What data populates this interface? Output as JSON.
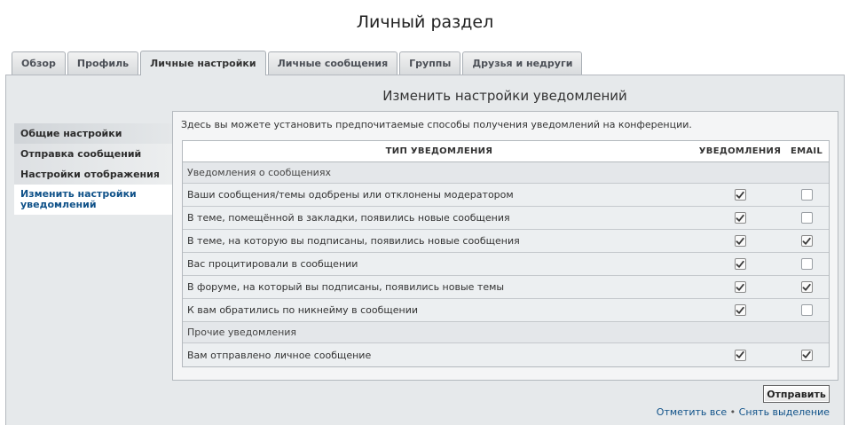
{
  "page": {
    "title": "Личный раздел"
  },
  "tabs": [
    {
      "label": "Обзор",
      "active": false
    },
    {
      "label": "Профиль",
      "active": false
    },
    {
      "label": "Личные настройки",
      "active": true
    },
    {
      "label": "Личные сообщения",
      "active": false
    },
    {
      "label": "Группы",
      "active": false
    },
    {
      "label": "Друзья и недруги",
      "active": false
    }
  ],
  "section": {
    "title": "Изменить настройки уведомлений"
  },
  "sidebar": {
    "items": [
      {
        "label": "Общие настройки",
        "active": false
      },
      {
        "label": "Отправка сообщений",
        "active": false
      },
      {
        "label": "Настройки отображения",
        "active": false
      },
      {
        "label": "Изменить настройки уведомлений",
        "active": true
      }
    ]
  },
  "intro_text": "Здесь вы можете установить предпочитаемые способы получения уведомлений на конференции.",
  "table": {
    "headers": {
      "type": "ТИП УВЕДОМЛЕНИЯ",
      "notifications": "УВЕДОМЛЕНИЯ",
      "email": "EMAIL"
    },
    "groups": [
      {
        "title": "Уведомления о сообщениях",
        "rows": [
          {
            "label": "Ваши сообщения/темы одобрены или отклонены модератором",
            "notification": true,
            "email": false
          },
          {
            "label": "В теме, помещённой в закладки, появились новые сообщения",
            "notification": true,
            "email": false
          },
          {
            "label": "В теме, на которую вы подписаны, появились новые сообщения",
            "notification": true,
            "email": true
          },
          {
            "label": "Вас процитировали в сообщении",
            "notification": true,
            "email": false
          },
          {
            "label": "В форуме, на который вы подписаны, появились новые темы",
            "notification": true,
            "email": true
          },
          {
            "label": "К вам обратились по никнейму в сообщении",
            "notification": true,
            "email": false
          }
        ]
      },
      {
        "title": "Прочие уведомления",
        "rows": [
          {
            "label": "Вам отправлено личное сообщение",
            "notification": true,
            "email": true
          }
        ]
      }
    ]
  },
  "actions": {
    "submit_label": "Отправить",
    "mark_all_label": "Отметить все",
    "separator": "•",
    "unmark_all_label": "Снять выделение"
  },
  "colors": {
    "link": "#105289",
    "panel": "#e6e9eb",
    "row": "#eceff1"
  },
  "icons": {
    "checkbox_tick": "checkmark-icon"
  }
}
